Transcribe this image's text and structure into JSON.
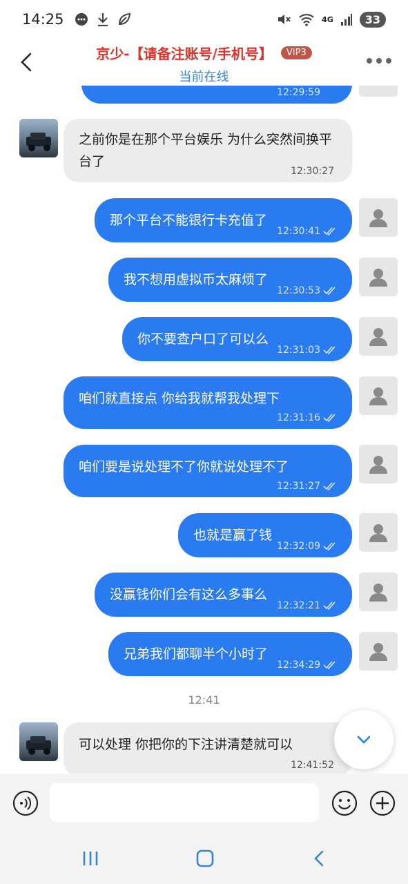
{
  "status_bar": {
    "time": "14:25",
    "network": "4G",
    "battery": "33"
  },
  "header": {
    "title": "京少-【请备注账号/手机号】",
    "vip": "VIP3",
    "subtitle": "当前在线"
  },
  "chat": {
    "partial_top_time": "12:29:59",
    "messages": [
      {
        "dir": "in",
        "text": "之前你是在那个平台娱乐 为什么突然间换平台了",
        "time": "12:30:27"
      },
      {
        "dir": "out",
        "text": "那个平台不能银行卡充值了",
        "time": "12:30:41"
      },
      {
        "dir": "out",
        "text": "我不想用虚拟币太麻烦了",
        "time": "12:30:53"
      },
      {
        "dir": "out",
        "text": "你不要查户口了可以么",
        "time": "12:31:03"
      },
      {
        "dir": "out",
        "text": "咱们就直接点 你给我就帮我处理下",
        "time": "12:31:16"
      },
      {
        "dir": "out",
        "text": "咱们要是说处理不了你就说处理不了",
        "time": "12:31:27"
      },
      {
        "dir": "out",
        "text": "也就是赢了钱",
        "time": "12:32:09"
      },
      {
        "dir": "out",
        "text": "没赢钱你们会有这么多事么",
        "time": "12:32:21"
      },
      {
        "dir": "out",
        "text": "兄弟我们都聊半个小时了",
        "time": "12:34:29"
      },
      {
        "dir": "in",
        "text": "可以处理 你把你的下注讲清楚就可以",
        "time": "12:41:52"
      }
    ],
    "separator_time": "12:41"
  },
  "input": {
    "placeholder": ""
  },
  "icons": {
    "back": "chevron-left-icon",
    "more": "more-dots-icon",
    "voice": "voice-icon",
    "emoji": "emoji-icon",
    "plus": "plus-icon",
    "scroll_down": "chevron-down-icon"
  },
  "colors": {
    "out_bubble": "#2a7bf0",
    "in_bubble": "#ececec",
    "title": "#d9342b",
    "subtitle": "#3a86c9"
  }
}
